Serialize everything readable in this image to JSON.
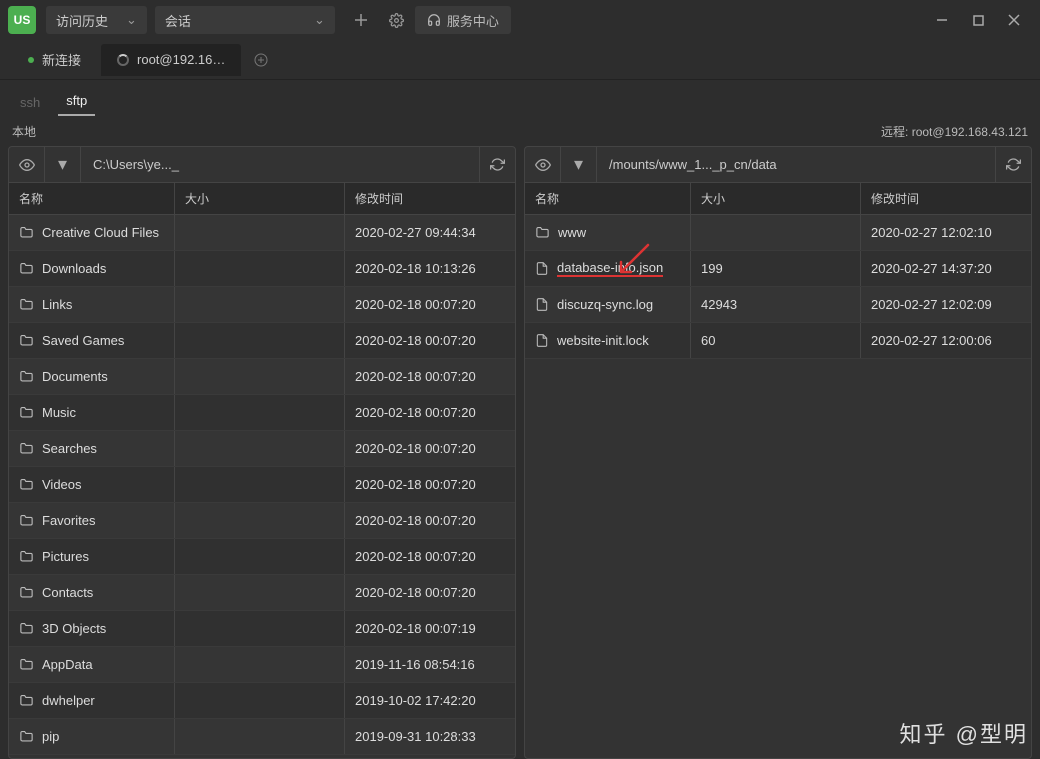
{
  "titlebar": {
    "logo_text": "US",
    "history_label": "访问历史",
    "session_label": "会话",
    "service_center": "服务中心"
  },
  "tabs": {
    "new_tab": "新连接",
    "active_tab": "root@192.16…"
  },
  "proto": {
    "ssh": "ssh",
    "sftp": "sftp"
  },
  "panel_labels": {
    "local": "本地",
    "remote": "远程: root@192.168.43.121"
  },
  "columns": {
    "name": "名称",
    "size": "大小",
    "mtime": "修改时间"
  },
  "local": {
    "path": "C:\\Users\\ye..._",
    "rows": [
      {
        "type": "folder",
        "name": "Creative Cloud Files",
        "size": "",
        "mtime": "2020-02-27 09:44:34"
      },
      {
        "type": "folder",
        "name": "Downloads",
        "size": "",
        "mtime": "2020-02-18 10:13:26"
      },
      {
        "type": "folder",
        "name": "Links",
        "size": "",
        "mtime": "2020-02-18 00:07:20"
      },
      {
        "type": "folder",
        "name": "Saved Games",
        "size": "",
        "mtime": "2020-02-18 00:07:20"
      },
      {
        "type": "folder",
        "name": "Documents",
        "size": "",
        "mtime": "2020-02-18 00:07:20"
      },
      {
        "type": "folder",
        "name": "Music",
        "size": "",
        "mtime": "2020-02-18 00:07:20"
      },
      {
        "type": "folder",
        "name": "Searches",
        "size": "",
        "mtime": "2020-02-18 00:07:20"
      },
      {
        "type": "folder",
        "name": "Videos",
        "size": "",
        "mtime": "2020-02-18 00:07:20"
      },
      {
        "type": "folder",
        "name": "Favorites",
        "size": "",
        "mtime": "2020-02-18 00:07:20"
      },
      {
        "type": "folder",
        "name": "Pictures",
        "size": "",
        "mtime": "2020-02-18 00:07:20"
      },
      {
        "type": "folder",
        "name": "Contacts",
        "size": "",
        "mtime": "2020-02-18 00:07:20"
      },
      {
        "type": "folder",
        "name": "3D Objects",
        "size": "",
        "mtime": "2020-02-18 00:07:19"
      },
      {
        "type": "folder",
        "name": "AppData",
        "size": "",
        "mtime": "2019-11-16 08:54:16"
      },
      {
        "type": "folder",
        "name": "dwhelper",
        "size": "",
        "mtime": "2019-10-02 17:42:20"
      },
      {
        "type": "folder",
        "name": "pip",
        "size": "",
        "mtime": "2019-09-31 10:28:33"
      }
    ]
  },
  "remote": {
    "path": "/mounts/www_1..._p_cn/data",
    "rows": [
      {
        "type": "folder",
        "name": "www",
        "size": "",
        "mtime": "2020-02-27 12:02:10"
      },
      {
        "type": "file",
        "name": "database-info.json",
        "size": "199",
        "mtime": "2020-02-27 14:37:20",
        "highlight": true
      },
      {
        "type": "file",
        "name": "discuzq-sync.log",
        "size": "42943",
        "mtime": "2020-02-27 12:02:09"
      },
      {
        "type": "file",
        "name": "website-init.lock",
        "size": "60",
        "mtime": "2020-02-27 12:00:06"
      }
    ]
  },
  "watermark": "知乎 @型明"
}
